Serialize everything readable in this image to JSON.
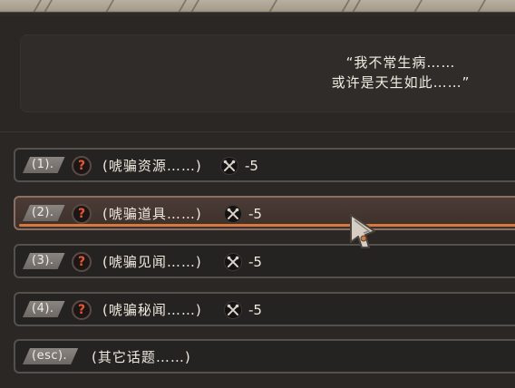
{
  "dialog": {
    "line1": "“我不常生病……",
    "line2": "或许是天生如此……”"
  },
  "options": [
    {
      "key": "(1).",
      "text": "(唬骗资源……)",
      "cost": "-5",
      "icon": "wrench-crossed-icon",
      "selected": false
    },
    {
      "key": "(2).",
      "text": "(唬骗道具……)",
      "cost": "-5",
      "icon": "wrench-crossed-icon",
      "selected": true
    },
    {
      "key": "(3).",
      "text": "(唬骗见闻……)",
      "cost": "-5",
      "icon": "wrench-crossed-icon",
      "selected": false
    },
    {
      "key": "(4).",
      "text": "(唬骗秘闻……)",
      "cost": "-5",
      "icon": "wrench-crossed-icon",
      "selected": false
    }
  ],
  "esc_option": {
    "key": "(esc).",
    "text": "(其它话题……)"
  },
  "icons": {
    "question": "?"
  },
  "colors": {
    "accent_orange": "#d7783f",
    "question_red": "#e8572e",
    "panel_bg": "#2f2c2a"
  }
}
